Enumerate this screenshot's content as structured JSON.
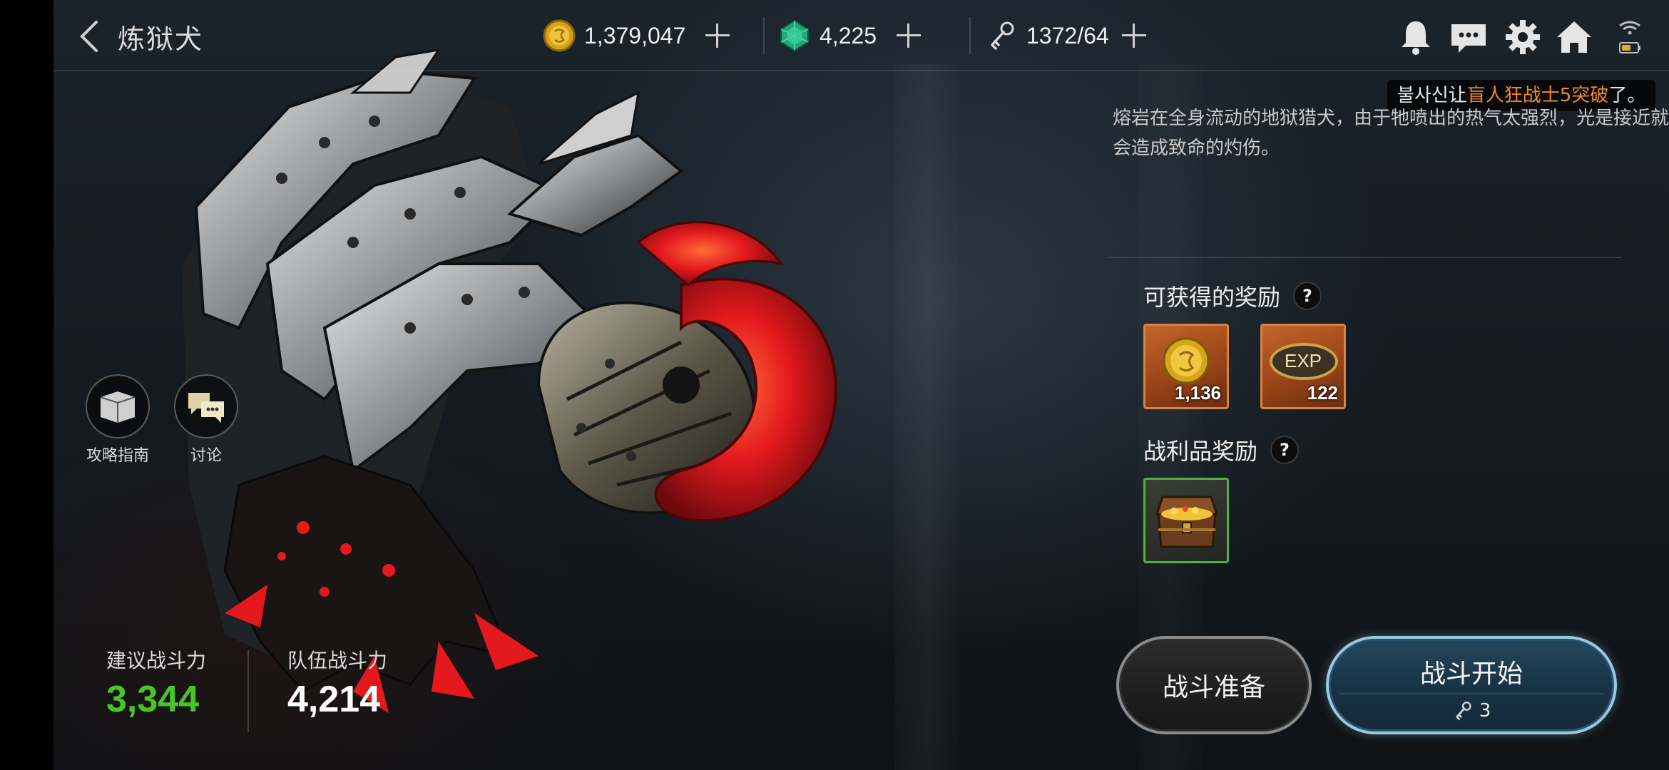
{
  "header": {
    "title": "炼狱犬"
  },
  "currencies": [
    {
      "name": "gold",
      "value": "1,379,047"
    },
    {
      "name": "gem",
      "value": "4,225"
    },
    {
      "name": "stamina",
      "value": "1372/64"
    }
  ],
  "notice": {
    "prefix": "불사신让",
    "highlight": "盲人狂战士5突破",
    "suffix": "了。"
  },
  "boss": {
    "description": "熔岩在全身流动的地狱猎犬，由于牠喷出的热气太强烈，光是接近就会造成致命的灼伤。"
  },
  "rewards": {
    "title": "可获得的奖励",
    "help": "?",
    "items": [
      {
        "icon": "gold-coin-icon",
        "count": "1,136"
      },
      {
        "icon": "exp-icon",
        "label": "EXP",
        "count": "122"
      }
    ]
  },
  "loot": {
    "title": "战利品奖励",
    "help": "?",
    "items": [
      {
        "icon": "treasure-chest-icon"
      }
    ]
  },
  "side_buttons": {
    "guide": "攻略指南",
    "discussion": "讨论"
  },
  "power": {
    "recommended_label": "建议战斗力",
    "recommended_value": "3,344",
    "team_label": "队伍战斗力",
    "team_value": "4,214"
  },
  "buttons": {
    "prepare": "战斗准备",
    "start": "战斗开始",
    "start_cost": "3"
  },
  "colors": {
    "recommended_power": "#48c626",
    "notice_highlight": "#f08a2c",
    "start_button_border": "#9bc9dc",
    "reward_tile_border": "#d6843f",
    "loot_tile_border": "#4bb53a"
  }
}
